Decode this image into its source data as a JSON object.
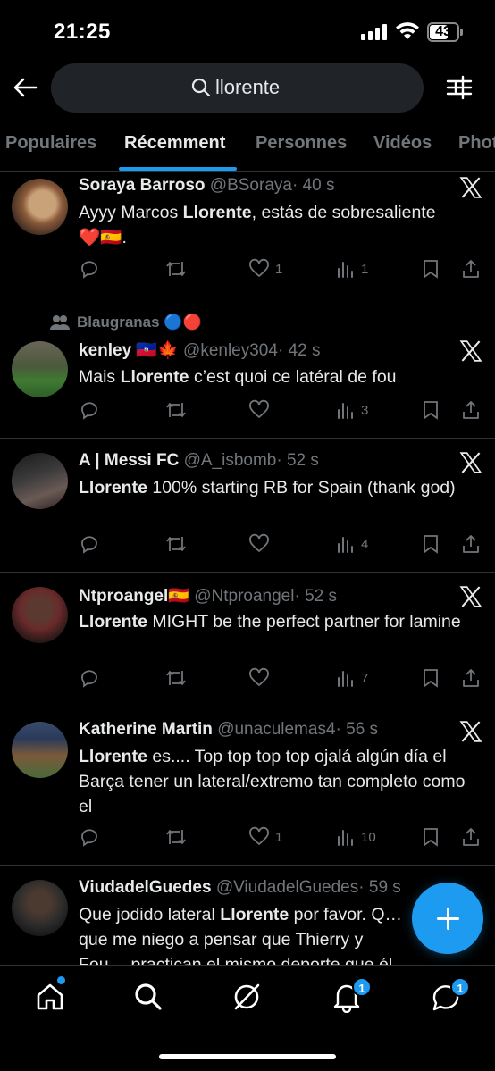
{
  "status_bar": {
    "time": "21:25",
    "battery": "43"
  },
  "search": {
    "query": "llorente"
  },
  "tabs": [
    {
      "label": "Populaires"
    },
    {
      "label": "Récemment"
    },
    {
      "label": "Personnes"
    },
    {
      "label": "Vidéos"
    },
    {
      "label": "Photos"
    }
  ],
  "tweets": [
    {
      "name": "Soraya Barroso",
      "handle": "@BSoraya",
      "time": "· 40 s",
      "text_1": "Ayyy Marcos ",
      "bold": "Llorente",
      "text_2": ", estás de sobresaliente",
      "emoji_line": "❤️🇪🇸.",
      "likes": "1",
      "views": "1"
    },
    {
      "context": "Blaugranas 🔵🔴",
      "name": "kenley 🇭🇹🍁",
      "handle": "@kenley304",
      "time": "· 42 s",
      "text_1": "Mais ",
      "bold": "Llorente",
      "text_2": " c’est quoi ce latéral de fou",
      "likes": "",
      "views": "3"
    },
    {
      "name": "A | Messi FC",
      "handle": "@A_isbomb",
      "time": "· 52 s",
      "bold": "Llorente",
      "text_2": " 100% starting RB for Spain (thank god)",
      "likes": "",
      "views": "4"
    },
    {
      "name": "Ntproangel🇪🇸",
      "handle": "@Ntproangel",
      "time": "· 52 s",
      "bold": "Llorente",
      "text_2": " MIGHT be the perfect partner for lamine",
      "likes": "",
      "views": "7"
    },
    {
      "name": "Katherine Martin",
      "handle": "@unaculemas4",
      "time": "· 56 s",
      "bold": "Llorente",
      "text_2": " es.... Top top top top ojalá algún día el Barça tener un lateral/extremo tan completo como el",
      "likes": "1",
      "views": "10"
    },
    {
      "name": "ViudadelGuedes",
      "handle": "@ViudadelGuedes",
      "time": "· 59 s",
      "text_1": "Que jodido lateral ",
      "bold": "Llorente",
      "text_2": " por favor. Q… que me niego a pensar que Thierry y Fou… practican el mismo deporte que él"
    }
  ],
  "nav": {
    "notifications_badge": "1",
    "messages_badge": "1"
  },
  "colors": {
    "accent": "#1d9bf0",
    "background": "#000000",
    "muted": "#71767b"
  }
}
